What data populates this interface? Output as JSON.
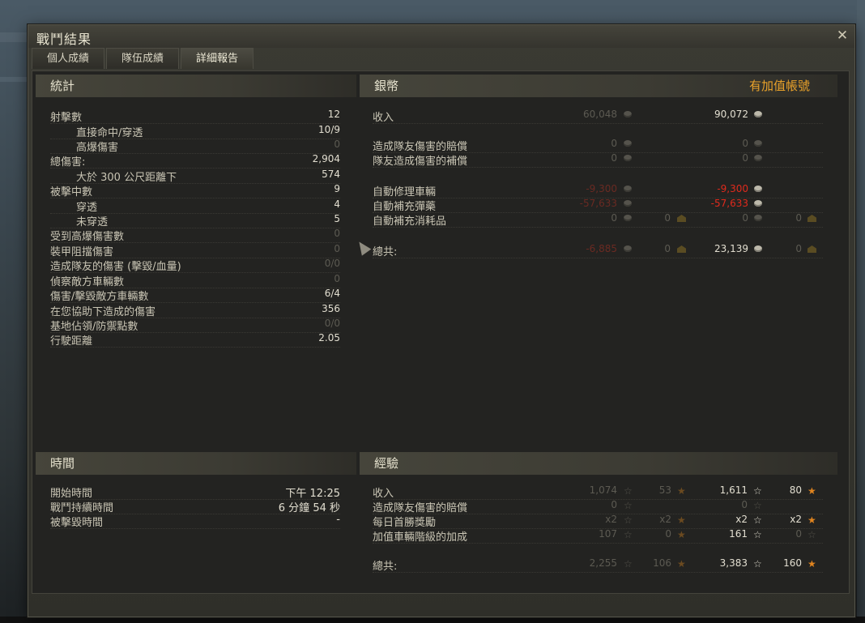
{
  "window": {
    "title": "戰鬥結果",
    "close_glyph": "✕"
  },
  "tabs": [
    {
      "label": "個人成績",
      "active": false
    },
    {
      "label": "隊伍成績",
      "active": false
    },
    {
      "label": "詳細報告",
      "active": true
    }
  ],
  "stats": {
    "heading": "統計",
    "rows": [
      {
        "label": "射擊數",
        "value": "12",
        "indent": false,
        "dim": false
      },
      {
        "label": "直接命中/穿透",
        "value": "10/9",
        "indent": true,
        "dim": false
      },
      {
        "label": "高爆傷害",
        "value": "0",
        "indent": true,
        "dim": true
      },
      {
        "label": "總傷害:",
        "value": "2,904",
        "indent": false,
        "dim": false
      },
      {
        "label": "大於 300 公尺距離下",
        "value": "574",
        "indent": true,
        "dim": false
      },
      {
        "label": "被擊中數",
        "value": "9",
        "indent": false,
        "dim": false
      },
      {
        "label": "穿透",
        "value": "4",
        "indent": true,
        "dim": false
      },
      {
        "label": "未穿透",
        "value": "5",
        "indent": true,
        "dim": false
      },
      {
        "label": "受到高爆傷害數",
        "value": "0",
        "indent": false,
        "dim": true
      },
      {
        "label": "裝甲阻擋傷害",
        "value": "0",
        "indent": false,
        "dim": true
      },
      {
        "label": "造成隊友的傷害 (擊毀/血量)",
        "value": "0/0",
        "indent": false,
        "dim": true
      },
      {
        "label": "偵察敵方車輛數",
        "value": "0",
        "indent": false,
        "dim": true
      },
      {
        "label": "傷害/擊毀敵方車輛數",
        "value": "6/4",
        "indent": false,
        "dim": false
      },
      {
        "label": "在您協助下造成的傷害",
        "value": "356",
        "indent": false,
        "dim": false
      },
      {
        "label": "基地佔領/防禦點數",
        "value": "0/0",
        "indent": false,
        "dim": true
      },
      {
        "label": "行駛距離",
        "value": "2.05",
        "indent": false,
        "dim": false
      }
    ]
  },
  "credits": {
    "heading": "銀幣",
    "premium_label": "有加值帳號",
    "rows": [
      {
        "label": "收入",
        "basic": "60,048",
        "basic_style": "dim",
        "basic_gold": null,
        "premium": "90,072",
        "premium_style": "normal",
        "premium_gold": null
      },
      {
        "label": "造成隊友傷害的賠償",
        "basic": "0",
        "basic_style": "dim",
        "basic_gold": null,
        "premium": "0",
        "premium_style": "dim",
        "premium_gold": null
      },
      {
        "label": "隊友造成傷害的補償",
        "basic": "0",
        "basic_style": "dim",
        "basic_gold": null,
        "premium": "0",
        "premium_style": "dim",
        "premium_gold": null
      },
      {
        "label": "自動修理車輛",
        "basic": "-9,300",
        "basic_style": "reddim",
        "basic_gold": null,
        "premium": "-9,300",
        "premium_style": "red",
        "premium_gold": null
      },
      {
        "label": "自動補充彈藥",
        "basic": "-57,633",
        "basic_style": "reddim",
        "basic_gold": null,
        "premium": "-57,633",
        "premium_style": "red",
        "premium_gold": null
      },
      {
        "label": "自動補充消耗品",
        "basic": "0",
        "basic_style": "dim",
        "basic_gold": "0",
        "premium": "0",
        "premium_style": "dim",
        "premium_gold": "0"
      },
      {
        "label": "總共:",
        "basic": "-6,885",
        "basic_style": "reddim",
        "basic_gold": "0",
        "premium": "23,139",
        "premium_style": "normal",
        "premium_gold": "0"
      }
    ]
  },
  "time": {
    "heading": "時間",
    "rows": [
      {
        "label": "開始時間",
        "value": "下午 12:25"
      },
      {
        "label": "戰鬥持續時間",
        "value": "6 分鐘 54 秒"
      },
      {
        "label": "被擊毀時間",
        "value": "-"
      }
    ]
  },
  "experience": {
    "heading": "經驗",
    "rows": [
      {
        "label": "收入",
        "b_xp": "1,074",
        "b_free": "53",
        "p_xp": "1,611",
        "p_free": "80",
        "b_style": "dim",
        "p_style": "normal",
        "show_free": true
      },
      {
        "label": "造成隊友傷害的賠償",
        "b_xp": "0",
        "b_free": "",
        "p_xp": "0",
        "p_free": "",
        "b_style": "dim",
        "p_style": "dim",
        "show_free": false
      },
      {
        "label": "每日首勝獎勵",
        "b_xp": "x2",
        "b_free": "x2",
        "p_xp": "x2",
        "p_free": "x2",
        "b_style": "dim",
        "p_style": "normal",
        "show_free": true
      },
      {
        "label": "加值車輛階級的加成",
        "b_xp": "107",
        "b_free": "0",
        "p_xp": "161",
        "p_free": "0",
        "b_style": "dim",
        "p_style": "normal",
        "show_free": true,
        "p_free_dim": true
      },
      {
        "label": "總共:",
        "b_xp": "2,255",
        "b_free": "106",
        "p_xp": "3,383",
        "p_free": "160",
        "b_style": "dim",
        "p_style": "normal",
        "show_free": true
      }
    ]
  }
}
